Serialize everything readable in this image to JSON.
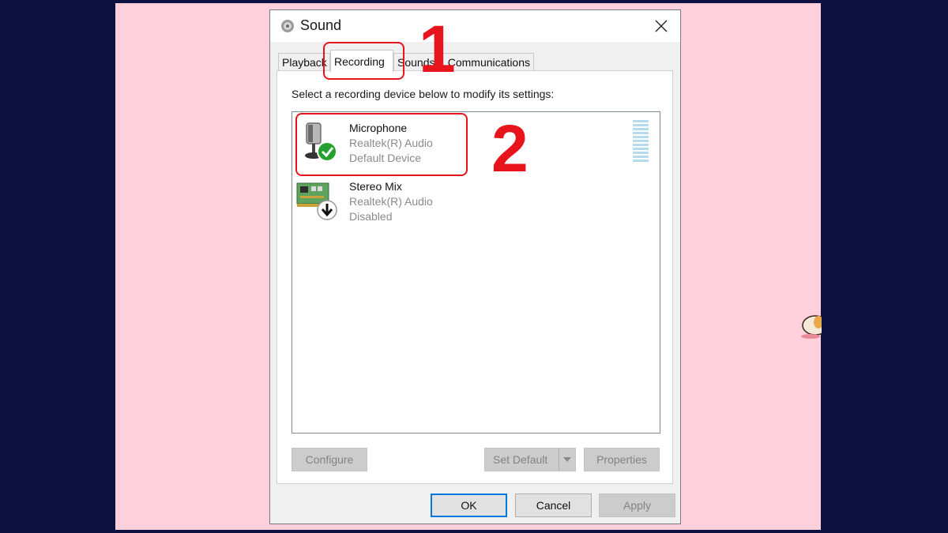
{
  "window": {
    "title": "Sound"
  },
  "tabs": [
    {
      "label": "Playback"
    },
    {
      "label": "Recording"
    },
    {
      "label": "Sounds"
    },
    {
      "label": "Communications"
    }
  ],
  "recording": {
    "instruction": "Select a recording device below to modify its settings:",
    "devices": [
      {
        "name": "Microphone",
        "driver": "Realtek(R) Audio",
        "status": "Default Device",
        "icon": "microphone-icon",
        "badge": "green-check-icon"
      },
      {
        "name": "Stereo Mix",
        "driver": "Realtek(R) Audio",
        "status": "Disabled",
        "icon": "sound-card-icon",
        "badge": "down-arrow-icon"
      }
    ]
  },
  "buttons": {
    "configure": "Configure",
    "set_default": "Set Default",
    "properties": "Properties",
    "ok": "OK",
    "cancel": "Cancel",
    "apply": "Apply"
  },
  "annotations": {
    "step1": "1",
    "step2": "2"
  },
  "colors": {
    "annotation": "#e8141c",
    "accent": "#0078d7",
    "pink_bg": "#fdd0dc",
    "navy_bg": "#0e1040"
  }
}
